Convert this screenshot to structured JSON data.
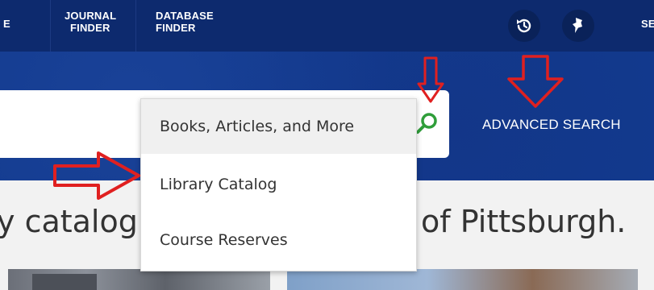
{
  "nav": {
    "partial_left": "E",
    "journal": [
      "JOURNAL",
      "FINDER"
    ],
    "database": [
      "DATABASE",
      "FINDER"
    ],
    "partial_right": "SE",
    "history_icon": "history-icon",
    "pin_icon": "pushpin-icon"
  },
  "search": {
    "advanced_label": "ADVANCED SEARCH",
    "icon": "search-icon",
    "accent": "#2f9e3a"
  },
  "dropdown": {
    "options": [
      "Books, Articles, and More",
      "Library Catalog",
      "Course Reserves"
    ],
    "selected_index": 0
  },
  "headline": {
    "left_fragment": "y catalog",
    "right_fragment": "of Pittsburgh."
  },
  "colors": {
    "nav_bg": "#0d2a6e",
    "hero_bg": "#123a8e",
    "annotation": "#e02020"
  }
}
